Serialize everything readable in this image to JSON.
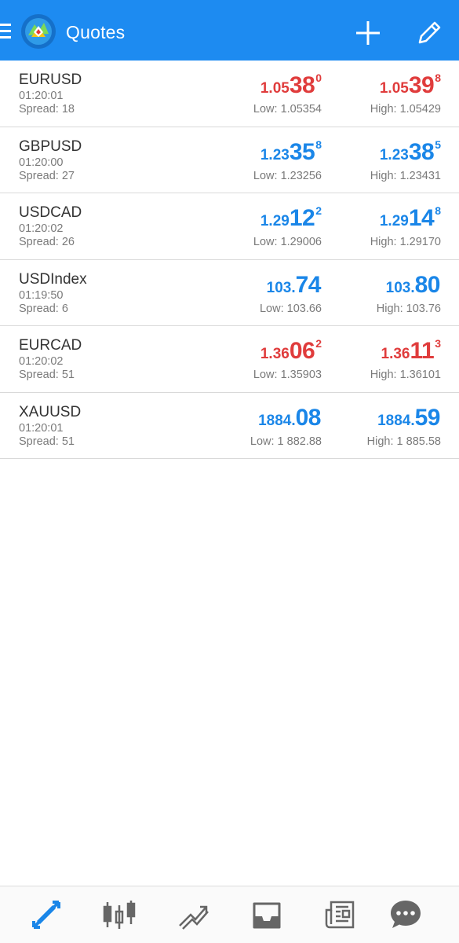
{
  "header": {
    "title": "Quotes"
  },
  "colors": {
    "accent": "#1d8bf1",
    "up": "#1a86e8",
    "down": "#e03c3c"
  },
  "quotes": [
    {
      "symbol": "EURUSD",
      "time": "01:20:01",
      "spread": "Spread: 18",
      "bid": {
        "small": "1.05",
        "big": "38",
        "sup": "0",
        "dir": "down"
      },
      "ask": {
        "small": "1.05",
        "big": "39",
        "sup": "8",
        "dir": "down"
      },
      "low": "Low: 1.05354",
      "high": "High: 1.05429"
    },
    {
      "symbol": "GBPUSD",
      "time": "01:20:00",
      "spread": "Spread: 27",
      "bid": {
        "small": "1.23",
        "big": "35",
        "sup": "8",
        "dir": "up"
      },
      "ask": {
        "small": "1.23",
        "big": "38",
        "sup": "5",
        "dir": "up"
      },
      "low": "Low: 1.23256",
      "high": "High: 1.23431"
    },
    {
      "symbol": "USDCAD",
      "time": "01:20:02",
      "spread": "Spread: 26",
      "bid": {
        "small": "1.29",
        "big": "12",
        "sup": "2",
        "dir": "up"
      },
      "ask": {
        "small": "1.29",
        "big": "14",
        "sup": "8",
        "dir": "up"
      },
      "low": "Low: 1.29006",
      "high": "High: 1.29170"
    },
    {
      "symbol": "USDIndex",
      "time": "01:19:50",
      "spread": "Spread: 6",
      "bid": {
        "small": "103.",
        "big": "74",
        "sup": "",
        "dir": "up"
      },
      "ask": {
        "small": "103.",
        "big": "80",
        "sup": "",
        "dir": "up"
      },
      "low": "Low: 103.66",
      "high": "High: 103.76"
    },
    {
      "symbol": "EURCAD",
      "time": "01:20:02",
      "spread": "Spread: 51",
      "bid": {
        "small": "1.36",
        "big": "06",
        "sup": "2",
        "dir": "down"
      },
      "ask": {
        "small": "1.36",
        "big": "11",
        "sup": "3",
        "dir": "down"
      },
      "low": "Low: 1.35903",
      "high": "High: 1.36101"
    },
    {
      "symbol": "XAUUSD",
      "time": "01:20:01",
      "spread": "Spread: 51",
      "bid": {
        "small": "1884.",
        "big": "08",
        "sup": "",
        "dir": "up"
      },
      "ask": {
        "small": "1884.",
        "big": "59",
        "sup": "",
        "dir": "up"
      },
      "low": "Low: 1 882.88",
      "high": "High: 1 885.58"
    }
  ],
  "bottom_nav": [
    {
      "icon": "quotes-arrows-icon",
      "active": true
    },
    {
      "icon": "candlestick-chart-icon",
      "active": false
    },
    {
      "icon": "trade-icon",
      "active": false
    },
    {
      "icon": "history-inbox-icon",
      "active": false
    },
    {
      "icon": "news-icon",
      "active": false
    },
    {
      "icon": "chat-icon",
      "active": false
    }
  ]
}
